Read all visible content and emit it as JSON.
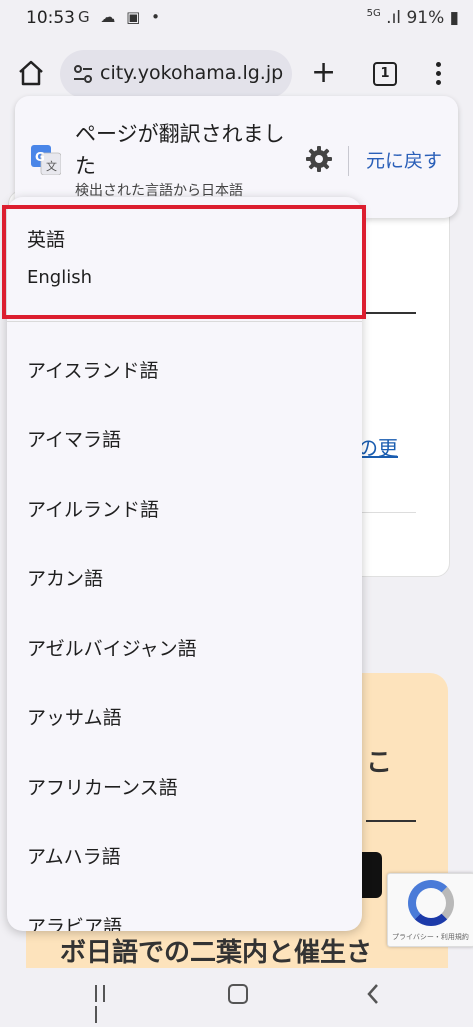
{
  "status_bar": {
    "time": "10:53",
    "left_icons": "G ☁ ▣ •",
    "network": "5G",
    "battery": "91%"
  },
  "toolbar": {
    "url": "city.yokohama.lg.jp",
    "tab_count": "1"
  },
  "translate_bar": {
    "title": "ページが翻訳されました",
    "subtitle": "検出された言語から日本語",
    "revert_label": "元に戻す"
  },
  "language_menu": {
    "selected": {
      "label": "英語",
      "native": "English"
    },
    "items": [
      "アイスランド語",
      "アイマラ語",
      "アイルランド語",
      "アカン語",
      "アゼルバイジャン語",
      "アッサム語",
      "アフリカーンス語",
      "アムハラ語",
      "アラビア語"
    ]
  },
  "background_page": {
    "link_fragment": "の更",
    "orange_heading_fragment": "こ",
    "orange_text_fragment": "ボ日語での二葉内と催生さ",
    "recaptcha_footer": "プライバシー・利用規約"
  },
  "colors": {
    "highlight": "#dc1e2f",
    "accent": "#2a5fb8",
    "orange_panel": "#fde3bc"
  }
}
